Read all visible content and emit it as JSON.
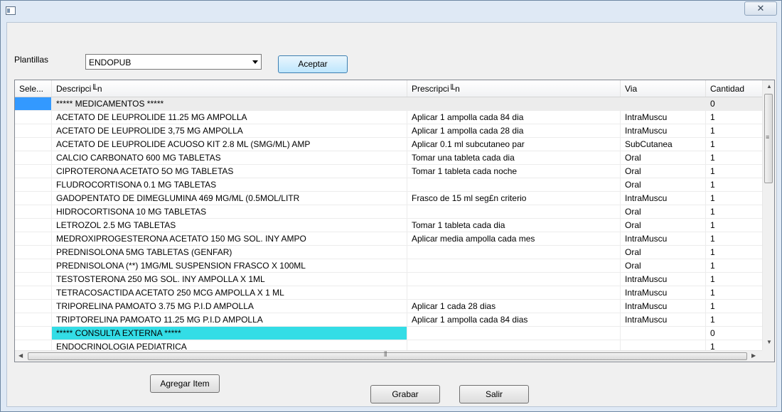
{
  "window": {
    "title": "",
    "close_glyph": "✕",
    "icon": "app-window-icon"
  },
  "toolbar": {
    "plantillas_label": "Plantillas",
    "template_selected": "ENDOPUB",
    "accept_label": "Aceptar"
  },
  "grid": {
    "columns": [
      "Sele...",
      "Descripci╙n",
      "Prescripci╙n",
      "Via",
      "Cantidad"
    ],
    "rows": [
      {
        "desc": "*****  MEDICAMENTOS  *****",
        "presc": "",
        "via": "",
        "qty": "0"
      },
      {
        "desc": "ACETATO DE LEUPROLIDE 11.25 MG AMPOLLA",
        "presc": "Aplicar  1 ampolla cada 84 dia",
        "via": "IntraMuscu",
        "qty": "1"
      },
      {
        "desc": "ACETATO DE LEUPROLIDE 3,75 MG AMPOLLA",
        "presc": "Aplicar 1 ampolla cada 28 dia",
        "via": "IntraMuscu",
        "qty": "1"
      },
      {
        "desc": "ACETATO DE LEUPROLIDE ACUOSO KIT 2.8 ML (SMG/ML) AMP",
        "presc": "Aplicar 0.1 ml subcutaneo par",
        "via": "SubCutanea",
        "qty": "1"
      },
      {
        "desc": "CALCIO CARBONATO 600 MG  TABLETAS",
        "presc": "Tomar una tableta cada dia",
        "via": "Oral",
        "qty": "1"
      },
      {
        "desc": "CIPROTERONA ACETATO 5O MG TABLETAS",
        "presc": "Tomar 1 tableta cada noche",
        "via": "Oral",
        "qty": "1"
      },
      {
        "desc": "FLUDROCORTISONA 0.1 MG TABLETAS",
        "presc": "",
        "via": "Oral",
        "qty": "1"
      },
      {
        "desc": "GADOPENTATO DE DIMEGLUMINA 469 MG/ML (0.5MOL/LITR",
        "presc": "Frasco  de 15 ml seg£n criterio",
        "via": "IntraMuscu",
        "qty": "1"
      },
      {
        "desc": "HIDROCORTISONA 10 MG TABLETAS",
        "presc": "",
        "via": "Oral",
        "qty": "1"
      },
      {
        "desc": "LETROZOL 2.5 MG TABLETAS",
        "presc": "Tomar 1 tableta cada dia",
        "via": "Oral",
        "qty": "1"
      },
      {
        "desc": "MEDROXIPROGESTERONA ACETATO 150 MG SOL. INY AMPO",
        "presc": "Aplicar media ampolla cada mes",
        "via": "IntraMuscu",
        "qty": "1"
      },
      {
        "desc": "PREDNISOLONA  5MG  TABLETAS (GENFAR)",
        "presc": "",
        "via": "Oral",
        "qty": "1"
      },
      {
        "desc": "PREDNISOLONA (**) 1MG/ML SUSPENSION FRASCO  X 100ML",
        "presc": "",
        "via": "Oral",
        "qty": "1"
      },
      {
        "desc": "TESTOSTERONA 250 MG SOL. INY AMPOLLA X 1ML",
        "presc": "",
        "via": "IntraMuscu",
        "qty": "1"
      },
      {
        "desc": "TETRACOSACTIDA ACETATO 250 MCG AMPOLLA X 1 ML",
        "presc": "",
        "via": "IntraMuscu",
        "qty": "1"
      },
      {
        "desc": "TRIPORELINA PAMOATO 3.75 MG P.I.D AMPOLLA",
        "presc": " Aplicar 1 cada 28 dias",
        "via": "IntraMuscu",
        "qty": "1"
      },
      {
        "desc": "TRIPTORELINA PAMOATO 11.25 MG P.I.D AMPOLLA",
        "presc": "Aplicar 1 ampolla cada 84 dias",
        "via": "IntraMuscu",
        "qty": "1"
      },
      {
        "desc": "*****  CONSULTA EXTERNA  *****",
        "presc": "",
        "via": "",
        "qty": "0"
      },
      {
        "desc": "ENDOCRINOLOGIA PEDIATRICA",
        "presc": "",
        "via": "",
        "qty": "1"
      }
    ]
  },
  "actions": {
    "add_item_label": "Agregar Item",
    "save_label": "Grabar",
    "exit_label": "Salir"
  },
  "colors": {
    "selection_blue": "#3399ff",
    "section_highlight": "#33dde6",
    "accent_button": "#bee6fd"
  }
}
